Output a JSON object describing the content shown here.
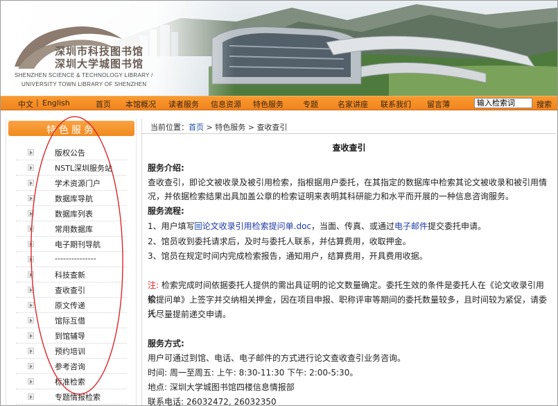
{
  "banner": {
    "cn_line1": "深圳市科技图书馆",
    "cn_line2": "深圳大学城图书馆",
    "en_line1": "SHENZHEN SCIENCE & TECHNOLOGY LIBRARY /",
    "en_line2": "UNIVERSITY TOWN LIBRARY OF SHENZHEN"
  },
  "nav": {
    "lang_cn": "中文",
    "lang_sep": "|",
    "lang_en": "English",
    "items": [
      "首页",
      "本馆概况",
      "读者服务",
      "信息资源",
      "特色服务",
      "专题",
      "名家讲座",
      "联系我们",
      "留言薄"
    ],
    "search_placeholder": "输入检索词",
    "search_button": "搜索"
  },
  "sidebar": {
    "heading": "特色服务",
    "items": [
      "版权公告",
      "NSTL深圳服务站",
      "学术资源门户",
      "数据库导航",
      "数据库列表",
      "常用数据库",
      "电子期刊导航",
      "---------------",
      "科技查新",
      "查收查引",
      "原文传递",
      "馆际互借",
      "到馆辅导",
      "预约培训",
      "参考咨询",
      "标准检索",
      "专题情报检索"
    ]
  },
  "breadcrumb": {
    "prefix": "当前位置：",
    "home": "首页",
    "arrow": ">",
    "level2": "特色服务",
    "current": "查收查引"
  },
  "article": {
    "title": "查收查引",
    "intro_heading": "服务介绍:",
    "intro_line1": "查收查引，即论文被收录及被引用检索，指根据用户委托，在其指定的数据库中检索其论文被收录和被引用情",
    "intro_line2": "况，并依据检索结果出具加盖公章的检索证明来表明其科研能力和水平而开展的一种信息咨询服务。",
    "process_heading": "服务流程:",
    "step1_prefix": "1、用户填写",
    "step1_link": "论文收录引用检索提问单.doc",
    "step1_mid": "，当面、传真、或通过",
    "step1_email": "电子邮件",
    "step1_suffix": "提交委托申请。",
    "step2": "2、馆员收到委托请求后，及时与委托人联系，并估算费用，收取押金。",
    "step3": "3、馆员在规定时间内完成检索报告，通知用户，结算费用，开具费用收据。",
    "note_label": "注:",
    "note_line1": " 检索完成时间依据委托人提供的需出具证明的论文数量确定。委托生效的条件是委托人在《论文收录引用检",
    "note_line2": "索提问单》上签字并交纳相关押金，因在项目申报、职称评审等期间的委托数量较多，且时间较为紧促，请委托",
    "note_line3": "人尽量提前递交申请。",
    "method_heading": "服务方式:",
    "method_line1": "用户可通过到馆、电话、电子邮件的方式进行论文查收查引业务咨询。",
    "hours": "时间: 周一至周五: 上午: 8:30-11:30  下午: 2:00-5:30。",
    "address": "地点: 深圳大学城图书馆四楼信息情报部",
    "phone": "联系电话: 26032472, 26032350"
  },
  "colors": {
    "nav_orange": "#f18420",
    "annotation_red": "#d9262b",
    "link_blue": "#1d3aa8"
  }
}
